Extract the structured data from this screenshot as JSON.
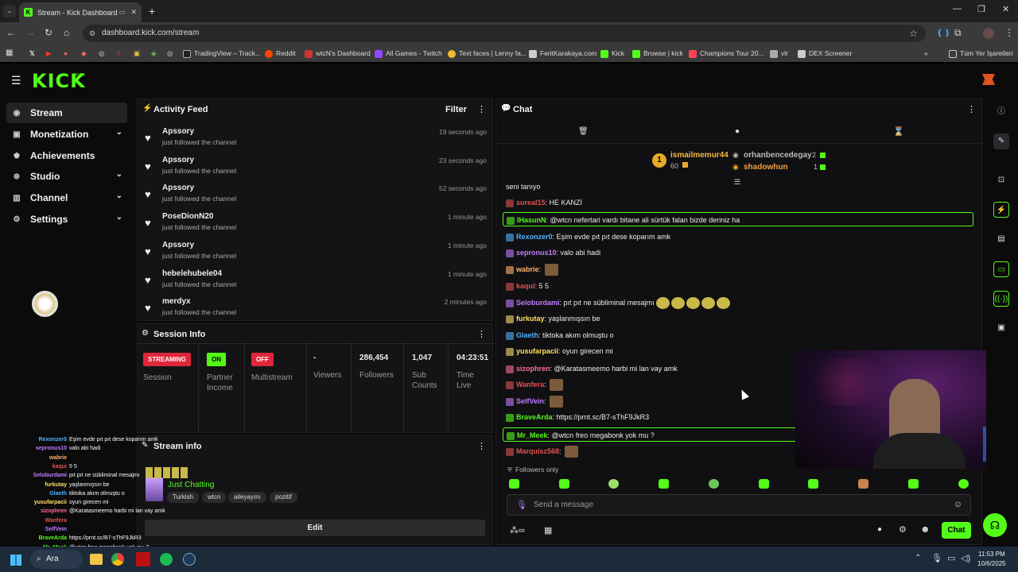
{
  "browser": {
    "tab_title": "Stream - Kick Dashboard",
    "url": "dashboard.kick.com/stream",
    "bookmarks": [
      "TradingView – Track...",
      "Reddit",
      "wtcN's Dashboard",
      "All Games - Twitch",
      "Text faces | Lenny fa...",
      "FeritKarakaya.com",
      "Kick",
      "Browse | kick",
      "Champions Tour 20...",
      "vlr",
      "DEX Screener"
    ],
    "all_bookmarks": "Tüm Yer İşaretleri"
  },
  "kick": {
    "logo": "KICK",
    "beta": "BETA"
  },
  "sidebar": {
    "items": [
      {
        "label": "Stream",
        "icon": "radio-icon",
        "active": true
      },
      {
        "label": "Monetization",
        "icon": "wallet-icon",
        "has_chevron": true
      },
      {
        "label": "Achievements",
        "icon": "trophy-icon"
      },
      {
        "label": "Studio",
        "icon": "studio-icon",
        "has_chevron": true
      },
      {
        "label": "Channel",
        "icon": "channel-icon",
        "has_chevron": true
      },
      {
        "label": "Settings",
        "icon": "gear-icon",
        "has_chevron": true
      }
    ]
  },
  "activity": {
    "title": "Activity Feed",
    "filter": "Filter",
    "items": [
      {
        "name": "Apssory",
        "action": "just followed the channel",
        "time": "19 seconds ago"
      },
      {
        "name": "Apssory",
        "action": "just followed the channel",
        "time": "23 seconds ago"
      },
      {
        "name": "Apssory",
        "action": "just followed the channel",
        "time": "52 seconds ago"
      },
      {
        "name": "PoseDionN20",
        "action": "just followed the channel",
        "time": "1 minute ago"
      },
      {
        "name": "Apssory",
        "action": "just followed the channel",
        "time": "1 minute ago"
      },
      {
        "name": "hebelehubele04",
        "action": "just followed the channel",
        "time": "1 minute ago"
      },
      {
        "name": "merdyx",
        "action": "just followed the channel",
        "time": "2 minutes ago"
      }
    ]
  },
  "session": {
    "title": "Session Info",
    "status_badge": "STREAMING",
    "status_label": "Session",
    "partner_badge": "ON",
    "partner_label": "Partner Income",
    "multistream_badge": "OFF",
    "multistream_label": "Multistream",
    "viewers_value": "-",
    "viewers_label": "Viewers",
    "followers_value": "286,454",
    "followers_label": "Followers",
    "subs_value": "1,047",
    "subs_label": "Sub Counts",
    "time_value": "04:23:51",
    "time_label": "Time Live"
  },
  "stream_info": {
    "title": "Stream info",
    "category": "Just Chatting",
    "tags": [
      "Turkish",
      "wtcn",
      "aileyayını",
      "pozitif"
    ],
    "edit": "Edit"
  },
  "chat": {
    "title": "Chat",
    "gifters": [
      {
        "name": "ismailmemur44",
        "count": "60"
      },
      {
        "name": "orhanbencedegay",
        "count": "2"
      },
      {
        "name": "shadowhun",
        "count": "1"
      }
    ],
    "messages": [
      {
        "user": "",
        "text": "seni tanıyo",
        "color": "#ddd"
      },
      {
        "user": "sureal15",
        "text": "HE KANZİ",
        "color": "#e05252"
      },
      {
        "user": "IHasunN",
        "text": "@wtcn nefertari vardı bitane ali sürtük falan bizde deriniz ha",
        "color": "#53fc18",
        "highlight": true
      },
      {
        "user": "Rexonzer0",
        "text": "Eşim evde pıt pıt dese koparım amk",
        "color": "#4fb3ff"
      },
      {
        "user": "sepronus10",
        "text": "valo abi hadi",
        "color": "#c07cff"
      },
      {
        "user": "wabrie",
        "text": "",
        "color": "#ffb36b",
        "emote": true
      },
      {
        "user": "kaqui",
        "text": "5 5",
        "color": "#e05252"
      },
      {
        "user": "Seloburdami",
        "text": "pıt pıt ne sübliminal mesajmı",
        "color": "#c07cff",
        "emotes": 5
      },
      {
        "user": "furkutay",
        "text": "yaşlanmışsın be",
        "color": "#ffe066"
      },
      {
        "user": "Glaeth",
        "text": "tiktoka akım olmuştu o",
        "color": "#4fb3ff"
      },
      {
        "user": "yusufarpacii",
        "text": "oyun girecen mi",
        "color": "#ffe066"
      },
      {
        "user": "sizophren",
        "text": "@Karatasmeemo harbi mi lan vay amk",
        "color": "#ff6b9d"
      },
      {
        "user": "Wanfera",
        "text": "",
        "color": "#e05252",
        "emote": true
      },
      {
        "user": "SelfVein",
        "text": "",
        "color": "#c07cff",
        "emote": true
      },
      {
        "user": "BraveArda",
        "text": "https://prnt.sc/B7-sThF9JkR3",
        "color": "#53fc18"
      },
      {
        "user": "Mr_Meek",
        "text": "@wtcn freo megabonk yok mu ?",
        "color": "#53fc18",
        "highlight": true
      },
      {
        "user": "Marquisz568",
        "text": "",
        "color": "#e05252",
        "emote": true
      }
    ],
    "followers_only": "Followers only",
    "placeholder": "Send a message",
    "chat_button": "Chat"
  },
  "overlay_chat": [
    {
      "user": "Rexonzer0",
      "text": "Eşim evde pıt pıt dese koparım amk",
      "color": "#4fb3ff"
    },
    {
      "user": "sepronus10",
      "text": "valo abi hadi",
      "color": "#c07cff"
    },
    {
      "user": "wabrie",
      "text": "",
      "color": "#ffb36b"
    },
    {
      "user": "kaqui",
      "text": "5 5",
      "color": "#e05252"
    },
    {
      "user": "Seloburdami",
      "text": "pıt pıt ne sübliminal mesajmı",
      "color": "#c07cff"
    },
    {
      "user": "furkutay",
      "text": "yaşlanmışsın be",
      "color": "#ffe066"
    },
    {
      "user": "Glaeth",
      "text": "tiktoka akım olmuştu o",
      "color": "#4fb3ff"
    },
    {
      "user": "yusufarpacii",
      "text": "oyun girecen mi",
      "color": "#ffe066"
    },
    {
      "user": "sizophren",
      "text": "@Karatasmeemo harbi mi lan vay amk",
      "color": "#ff6b9d"
    },
    {
      "user": "Wanfera",
      "text": "",
      "color": "#e05252"
    },
    {
      "user": "SelfVein",
      "text": "",
      "color": "#c07cff"
    },
    {
      "user": "BraveArda",
      "text": "https://prnt.sc/B7-sThF9JkR3",
      "color": "#53fc18"
    },
    {
      "user": "Mr_Meek",
      "text": "@wtcn freo megabonk yok mu ?",
      "color": "#53fc18"
    }
  ],
  "taskbar": {
    "search": "Ara",
    "time": "11:53 PM",
    "date": "10/6/2025"
  },
  "colors": {
    "kick_green": "#53fc18",
    "streaming_red": "#e0263a",
    "panel_bg": "#141416"
  }
}
